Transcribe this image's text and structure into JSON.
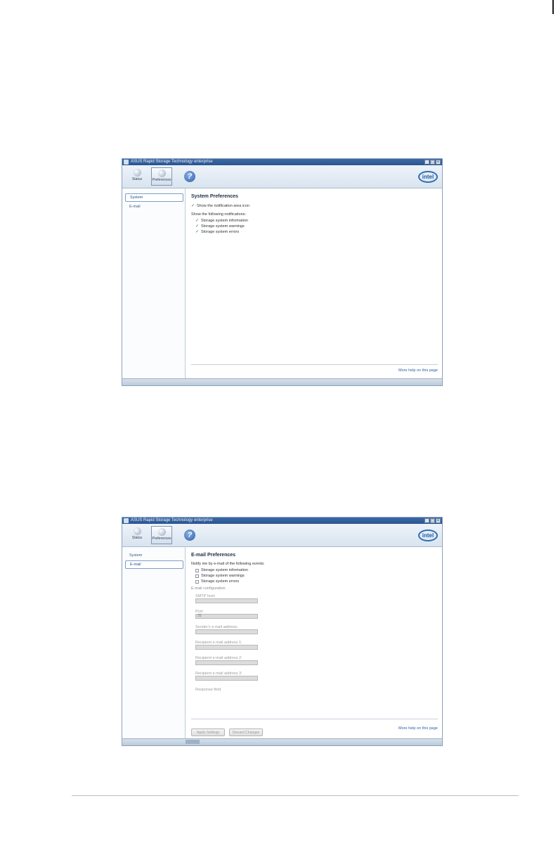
{
  "app": {
    "title": "ASUS Rapid Storage Technology enterprise",
    "toolbar": {
      "status_label": "Status",
      "preferences_label": "Preferences",
      "help_symbol": "?",
      "logo_text": "intel"
    },
    "window_buttons": [
      "_",
      "□",
      "×"
    ],
    "more_help": "More help on this page"
  },
  "window1": {
    "sidebar": [
      {
        "label": "System",
        "selected": true
      },
      {
        "label": "E-mail",
        "selected": false
      }
    ],
    "heading": "System Preferences",
    "show_notification_area": "Show the notification area icon",
    "notifications_label": "Show the following notifications:",
    "notifications": [
      "Storage system information",
      "Storage system warnings",
      "Storage system errors"
    ]
  },
  "window2": {
    "sidebar": [
      {
        "label": "System",
        "selected": false
      },
      {
        "label": "E-mail",
        "selected": true
      }
    ],
    "heading": "E-mail Preferences",
    "notify_label": "Notify me by e-mail of the following events:",
    "events": [
      "Storage system information",
      "Storage system warnings",
      "Storage system errors"
    ],
    "config_label": "E-mail configuration",
    "fields": [
      {
        "label": "SMTP host:",
        "value": ""
      },
      {
        "label": "Port:",
        "value": "25"
      },
      {
        "label": "Sender's e-mail address:",
        "value": ""
      },
      {
        "label": "Recipient e-mail address 1:",
        "value": ""
      },
      {
        "label": "Recipient e-mail address 2:",
        "value": ""
      },
      {
        "label": "Recipient e-mail address 3:",
        "value": ""
      }
    ],
    "response_label": "Response field",
    "apply_button": "Apply Settings",
    "discard_button": "Discard Changes"
  }
}
